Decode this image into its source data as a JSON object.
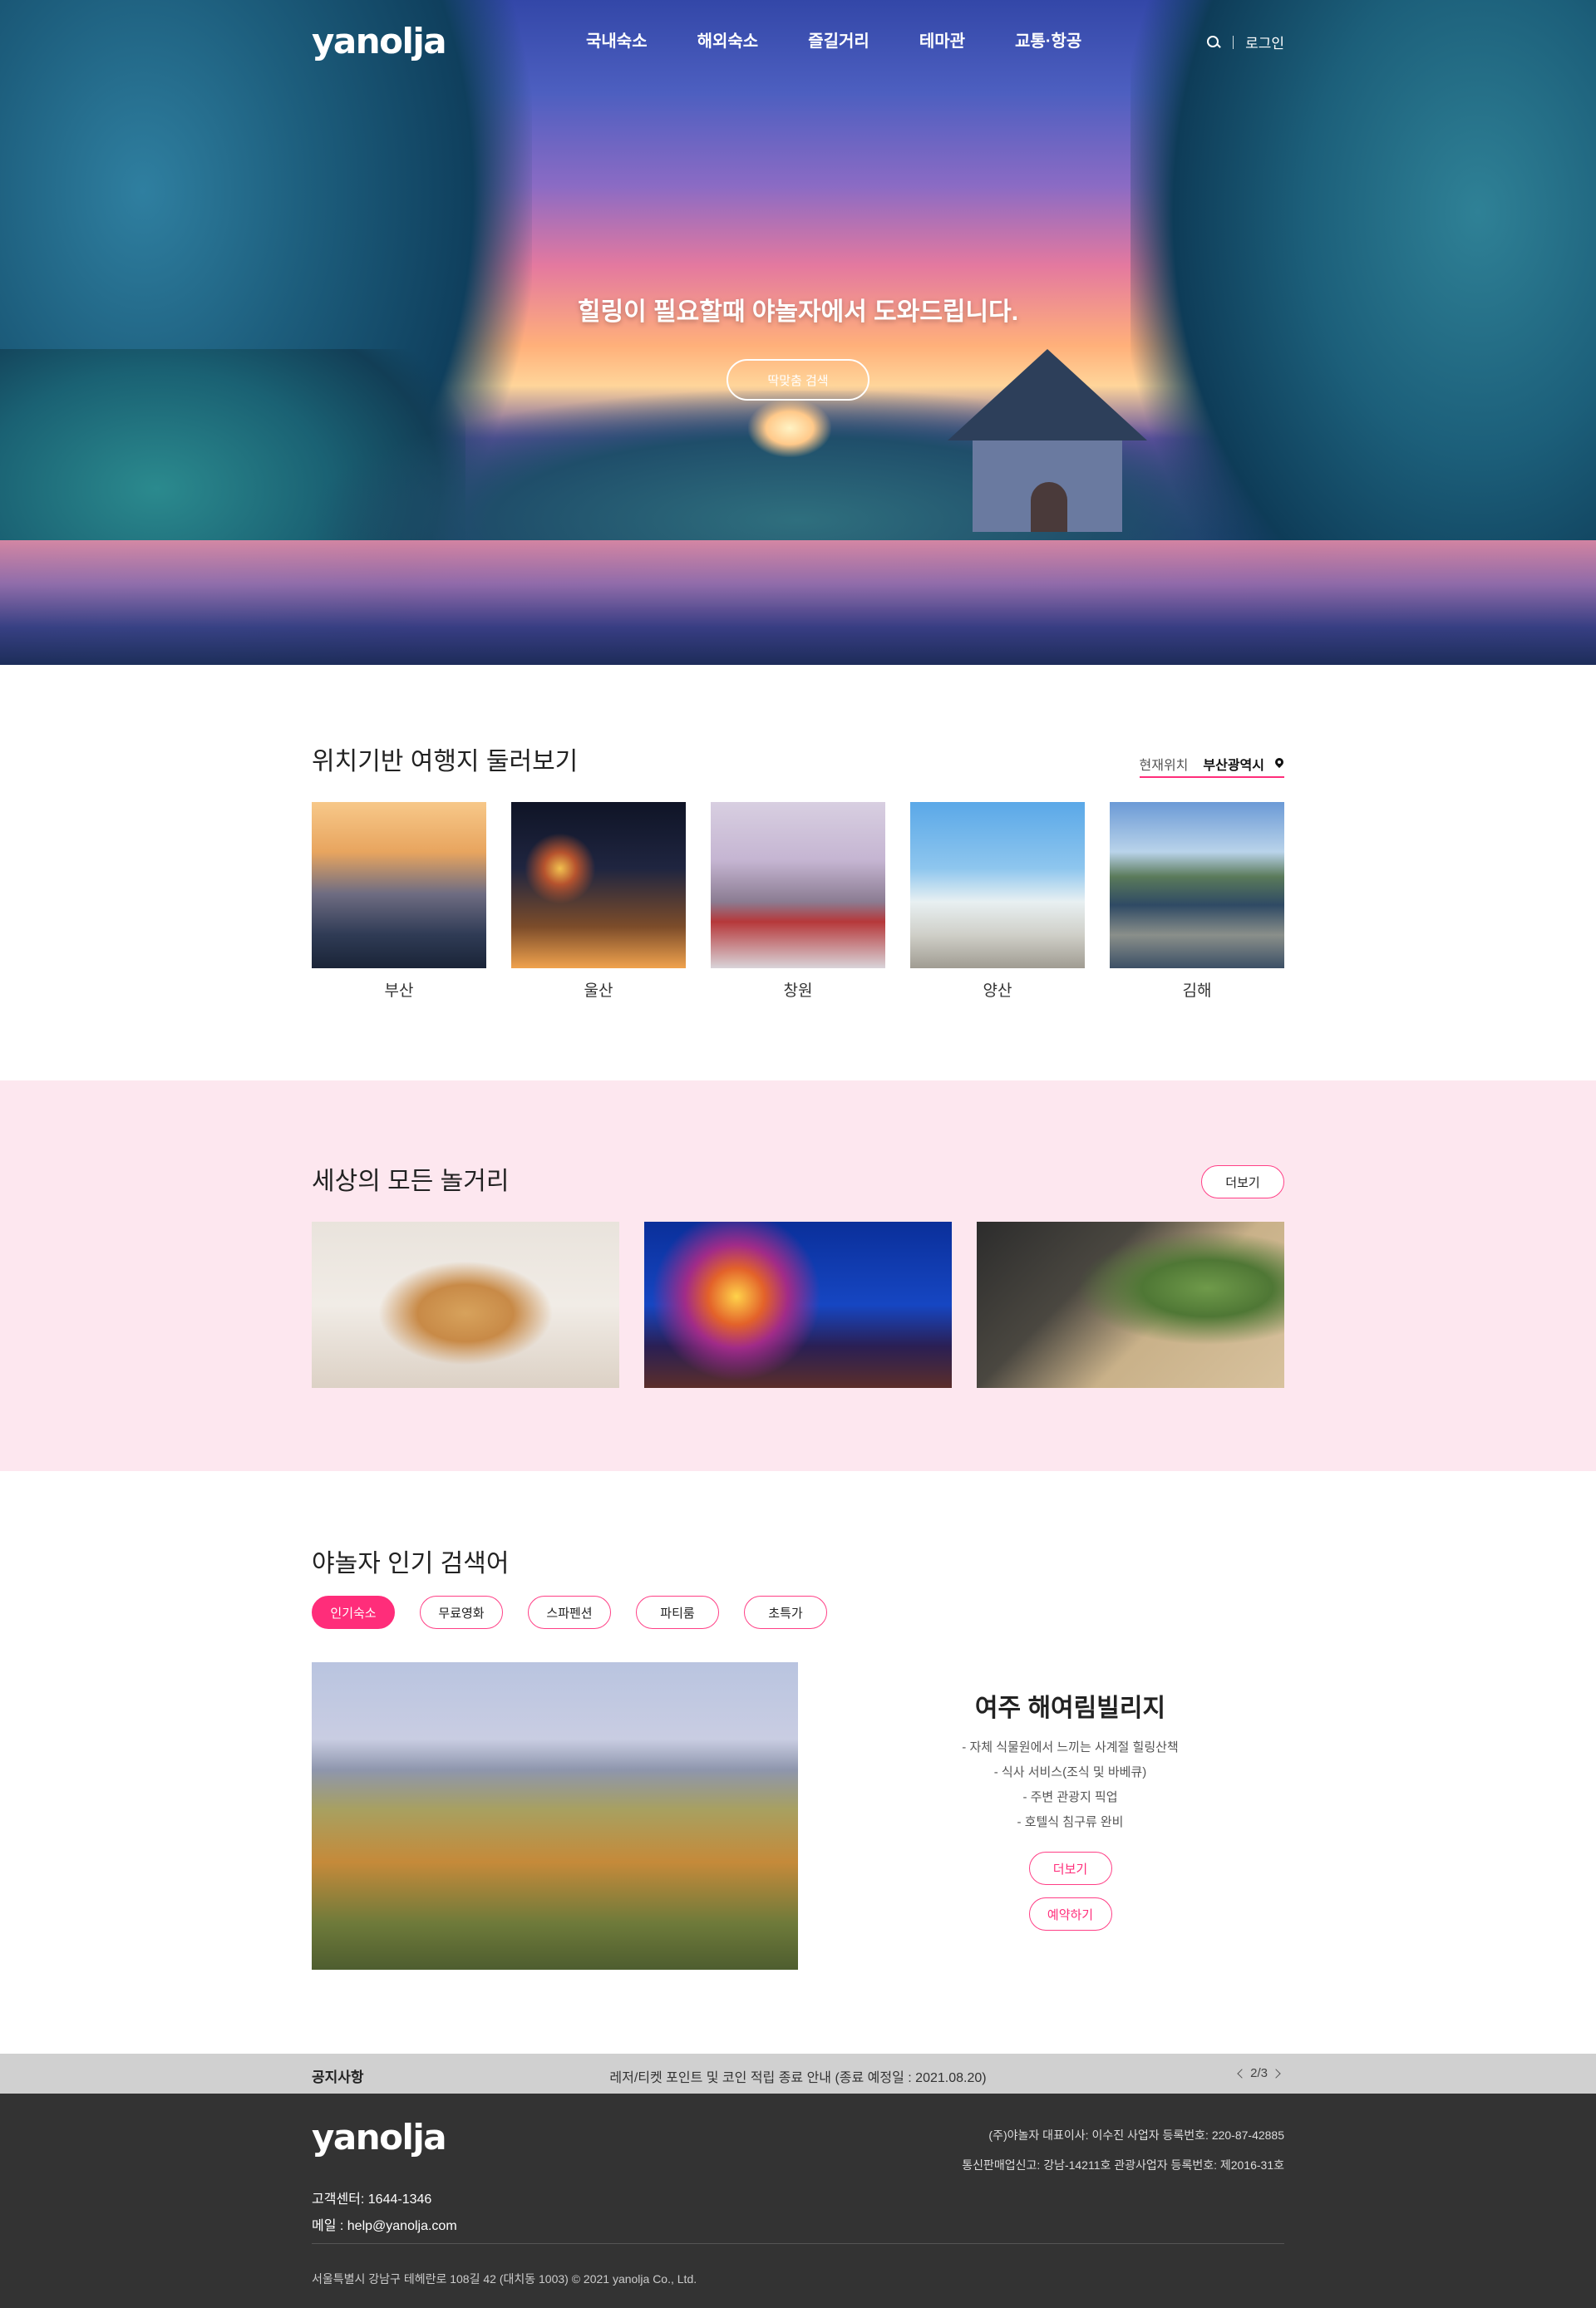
{
  "header": {
    "logo": "yanolja",
    "menu": [
      "국내숙소",
      "해외숙소",
      "즐길거리",
      "테마관",
      "교통·항공"
    ],
    "login": "로그인"
  },
  "hero": {
    "title": "힐링이 필요할때 야놀자에서 도와드립니다.",
    "button": "딱맞춤 검색"
  },
  "location": {
    "title": "위치기반 여행지 둘러보기",
    "current_label": "현재위치",
    "current_city": "부산광역시",
    "cities": [
      "부산",
      "울산",
      "창원",
      "양산",
      "김해"
    ]
  },
  "play": {
    "title": "세상의 모든 놀거리",
    "more": "더보기"
  },
  "popular": {
    "title": "야놀자 인기 검색어",
    "tags": [
      "인기숙소",
      "무료영화",
      "스파펜션",
      "파티룸",
      "초특가"
    ],
    "active_tag": "인기숙소",
    "name": "여주 해여림빌리지",
    "features": [
      "- 자체 식물원에서 느끼는 사계절 힐링산책",
      "- 식사 서비스(조식 및 바베큐)",
      "- 주변 관광지 픽업",
      "- 호텔식 침구류 완비"
    ],
    "more": "더보기",
    "reserve": "예약하기"
  },
  "notice": {
    "label": "공지사항",
    "text": "레저/티켓 포인트 및 코인 적립 종료 안내 (종료 예정일 : 2021.08.20)",
    "page": "2/3"
  },
  "footer": {
    "logo": "yanolja",
    "cs": "고객센터: 1644-1346",
    "email": "메일 : help@yanolja.com",
    "company1": "(주)야놀자 대표이사: 이수진 사업자 등록번호: 220-87-42885",
    "company2": "통신판매업신고: 강남-14211호 관광사업자 등록번호: 제2016-31호",
    "copyright": "서울특별시 강남구 테헤란로 108길 42 (대치동 1003) © 2021 yanolja Co., Ltd."
  },
  "colors": {
    "accent": "#ff2d7a",
    "play_bg": "#fde7ef",
    "notice_bg": "#d0d0d0",
    "footer_bg": "#333333"
  }
}
